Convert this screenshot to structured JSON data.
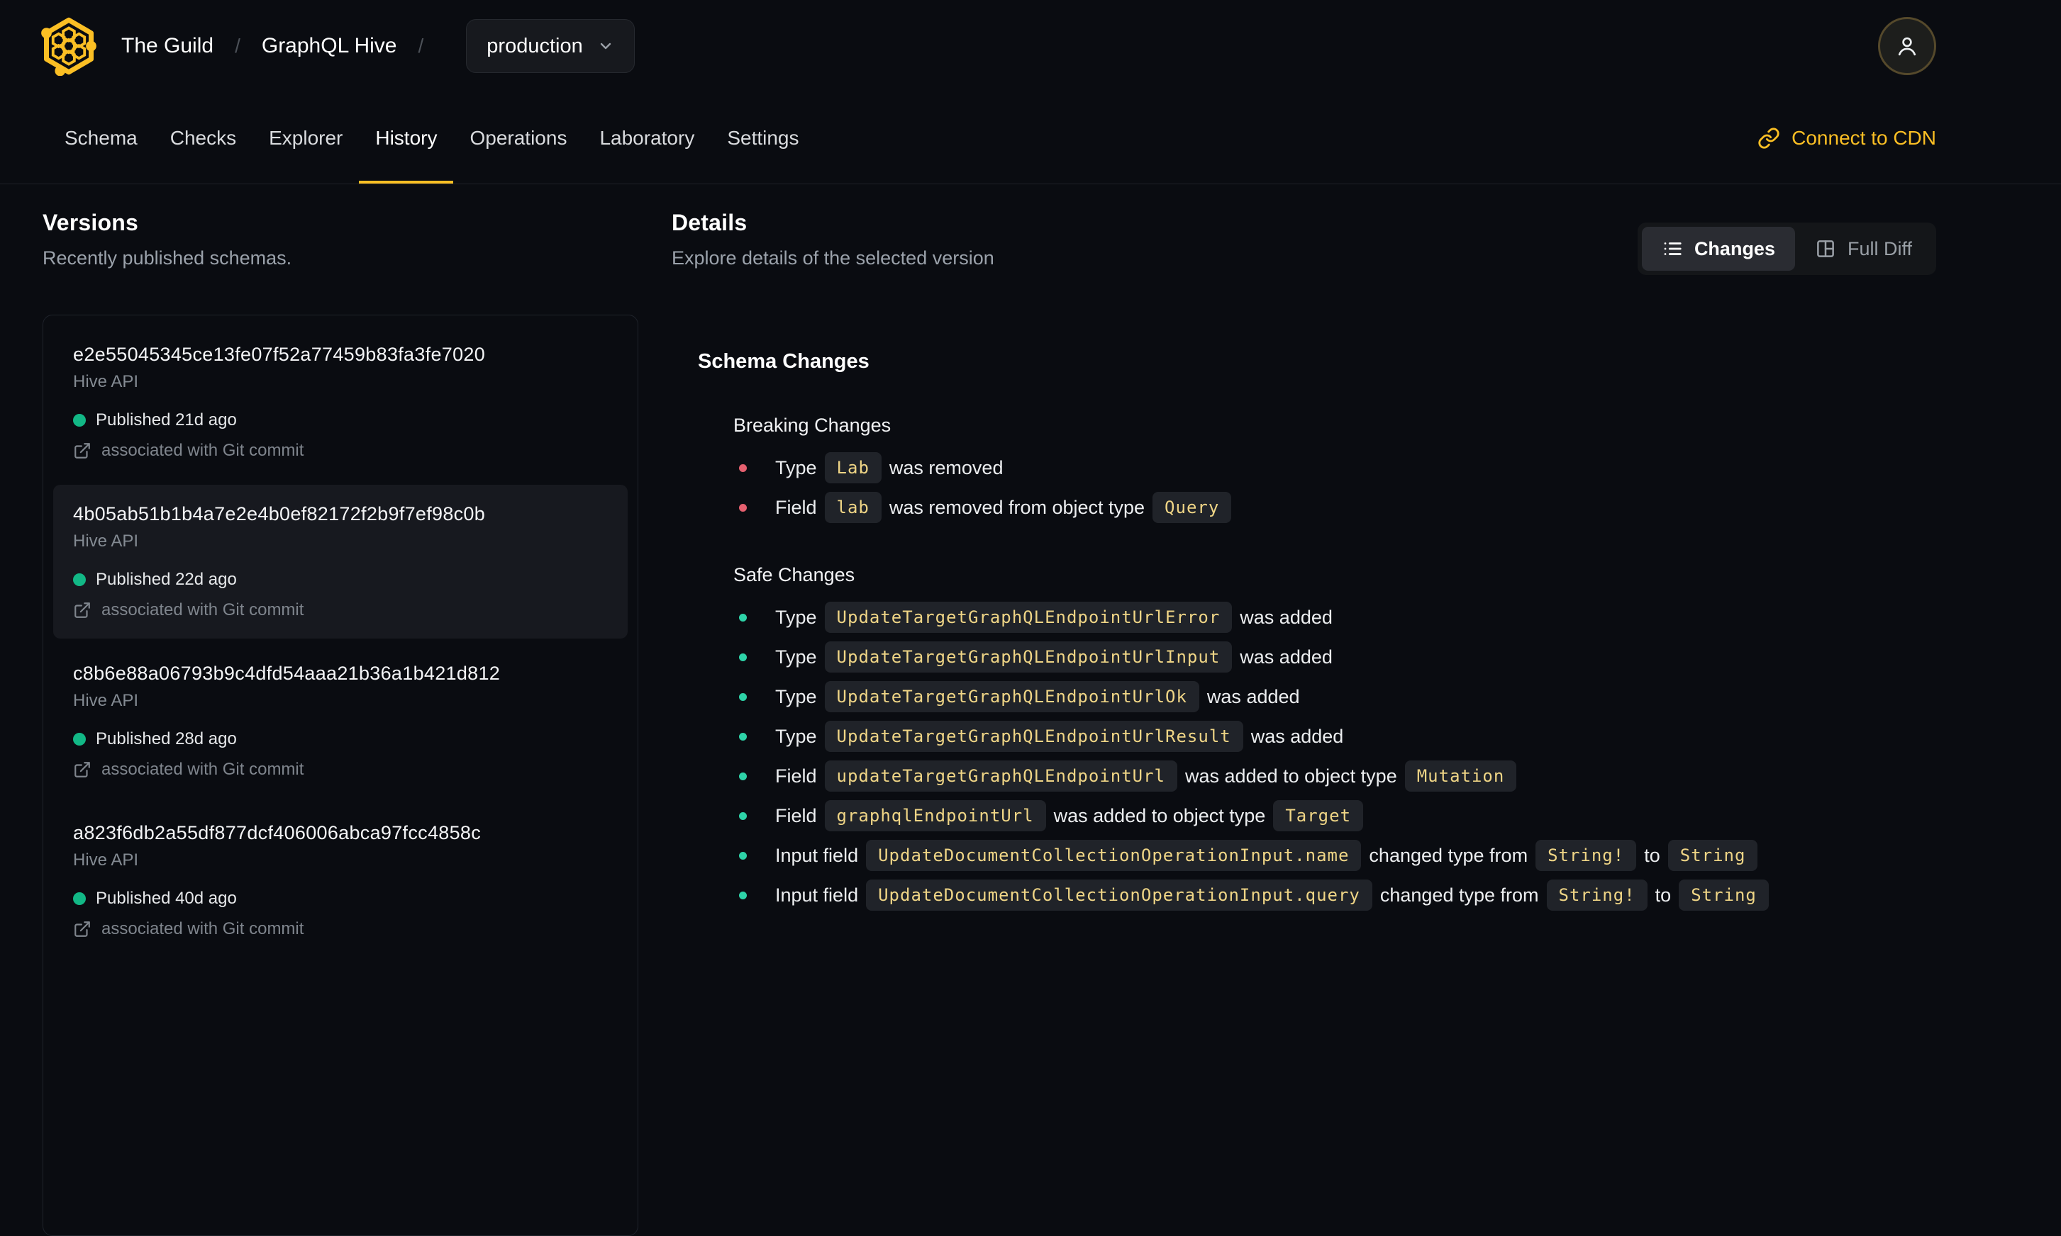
{
  "colors": {
    "accent": "#fbbf24",
    "published_dot": "#12b886",
    "breaking_bullet": "#e5606f",
    "safe_bullet": "#2ed3a8",
    "code_text": "#efd586"
  },
  "header": {
    "org": "The Guild",
    "separator": "/",
    "project": "GraphQL Hive",
    "target_selector": {
      "value": "production"
    }
  },
  "nav": {
    "tabs": [
      {
        "label": "Schema",
        "active": false
      },
      {
        "label": "Checks",
        "active": false
      },
      {
        "label": "Explorer",
        "active": false
      },
      {
        "label": "History",
        "active": true
      },
      {
        "label": "Operations",
        "active": false
      },
      {
        "label": "Laboratory",
        "active": false
      },
      {
        "label": "Settings",
        "active": false
      }
    ],
    "connect_cdn": "Connect to CDN"
  },
  "versions": {
    "title": "Versions",
    "subtitle": "Recently published schemas.",
    "items": [
      {
        "hash": "e2e55045345ce13fe07f52a77459b83fa3fe7020",
        "service": "Hive API",
        "published": "Published 21d ago",
        "git": "associated with Git commit",
        "selected": false
      },
      {
        "hash": "4b05ab51b1b4a7e2e4b0ef82172f2b9f7ef98c0b",
        "service": "Hive API",
        "published": "Published 22d ago",
        "git": "associated with Git commit",
        "selected": true
      },
      {
        "hash": "c8b6e88a06793b9c4dfd54aaa21b36a1b421d812",
        "service": "Hive API",
        "published": "Published 28d ago",
        "git": "associated with Git commit",
        "selected": false
      },
      {
        "hash": "a823f6db2a55df877dcf406006abca97fcc4858c",
        "service": "Hive API",
        "published": "Published 40d ago",
        "git": "associated with Git commit",
        "selected": false
      }
    ]
  },
  "details": {
    "title": "Details",
    "subtitle": "Explore details of the selected version",
    "toggle": {
      "changes": "Changes",
      "full_diff": "Full Diff"
    },
    "schema_changes_title": "Schema Changes",
    "breaking_title": "Breaking Changes",
    "breaking_items": [
      [
        [
          "text",
          "Type"
        ],
        [
          "code",
          "Lab"
        ],
        [
          "text",
          "was removed"
        ]
      ],
      [
        [
          "text",
          "Field"
        ],
        [
          "code",
          "lab"
        ],
        [
          "text",
          "was removed from object type"
        ],
        [
          "code",
          "Query"
        ]
      ]
    ],
    "safe_title": "Safe Changes",
    "safe_items": [
      [
        [
          "text",
          "Type"
        ],
        [
          "code",
          "UpdateTargetGraphQLEndpointUrlError"
        ],
        [
          "text",
          "was added"
        ]
      ],
      [
        [
          "text",
          "Type"
        ],
        [
          "code",
          "UpdateTargetGraphQLEndpointUrlInput"
        ],
        [
          "text",
          "was added"
        ]
      ],
      [
        [
          "text",
          "Type"
        ],
        [
          "code",
          "UpdateTargetGraphQLEndpointUrlOk"
        ],
        [
          "text",
          "was added"
        ]
      ],
      [
        [
          "text",
          "Type"
        ],
        [
          "code",
          "UpdateTargetGraphQLEndpointUrlResult"
        ],
        [
          "text",
          "was added"
        ]
      ],
      [
        [
          "text",
          "Field"
        ],
        [
          "code",
          "updateTargetGraphQLEndpointUrl"
        ],
        [
          "text",
          "was added to object type"
        ],
        [
          "code",
          "Mutation"
        ]
      ],
      [
        [
          "text",
          "Field"
        ],
        [
          "code",
          "graphqlEndpointUrl"
        ],
        [
          "text",
          "was added to object type"
        ],
        [
          "code",
          "Target"
        ]
      ],
      [
        [
          "text",
          "Input field"
        ],
        [
          "code",
          "UpdateDocumentCollectionOperationInput.name"
        ],
        [
          "text",
          "changed type from"
        ],
        [
          "code",
          "String!"
        ],
        [
          "text",
          "to"
        ],
        [
          "code",
          "String"
        ]
      ],
      [
        [
          "text",
          "Input field"
        ],
        [
          "code",
          "UpdateDocumentCollectionOperationInput.query"
        ],
        [
          "text",
          "changed type from"
        ],
        [
          "code",
          "String!"
        ],
        [
          "text",
          "to"
        ],
        [
          "code",
          "String"
        ]
      ]
    ]
  }
}
